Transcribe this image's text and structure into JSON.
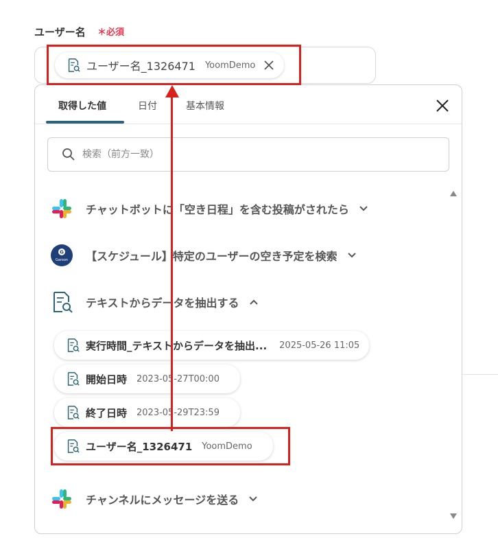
{
  "field": {
    "label": "ユーザー名",
    "required": "＊必須",
    "selected_chip": {
      "name": "ユーザー名_1326471",
      "value": "YoomDemo"
    }
  },
  "panel": {
    "tabs": [
      {
        "label": "取得した値",
        "active": true
      },
      {
        "label": "日付",
        "active": false
      },
      {
        "label": "基本情報",
        "active": false
      }
    ],
    "search_placeholder": "検索（前方一致）",
    "steps": [
      {
        "title": "チャットボットに「空き日程」を含む投稿がされたら",
        "icon": "slack-icon",
        "expanded": false
      },
      {
        "title": "【スケジュール】特定のユーザーの空き予定を検索",
        "icon": "garoon-icon",
        "expanded": false
      },
      {
        "title": "テキストからデータを抽出する",
        "icon": "document-search-icon",
        "expanded": true
      },
      {
        "title": "チャンネルにメッセージを送る",
        "icon": "slack-icon",
        "expanded": false
      }
    ],
    "output_items": [
      {
        "name": "実行時間_テキストからデータを抽出...",
        "value": "2025-05-26 11:05"
      },
      {
        "name": "開始日時",
        "value": "2023-05-27T00:00"
      },
      {
        "name": "終了日時",
        "value": "2023-05-29T23:59"
      },
      {
        "name": "ユーザー名_1326471",
        "value": "YoomDemo"
      }
    ],
    "garoon_logo_text": "Garoon"
  },
  "colors": {
    "accent": "#2a6478",
    "required": "#e8384f",
    "highlight": "#d8201c"
  }
}
